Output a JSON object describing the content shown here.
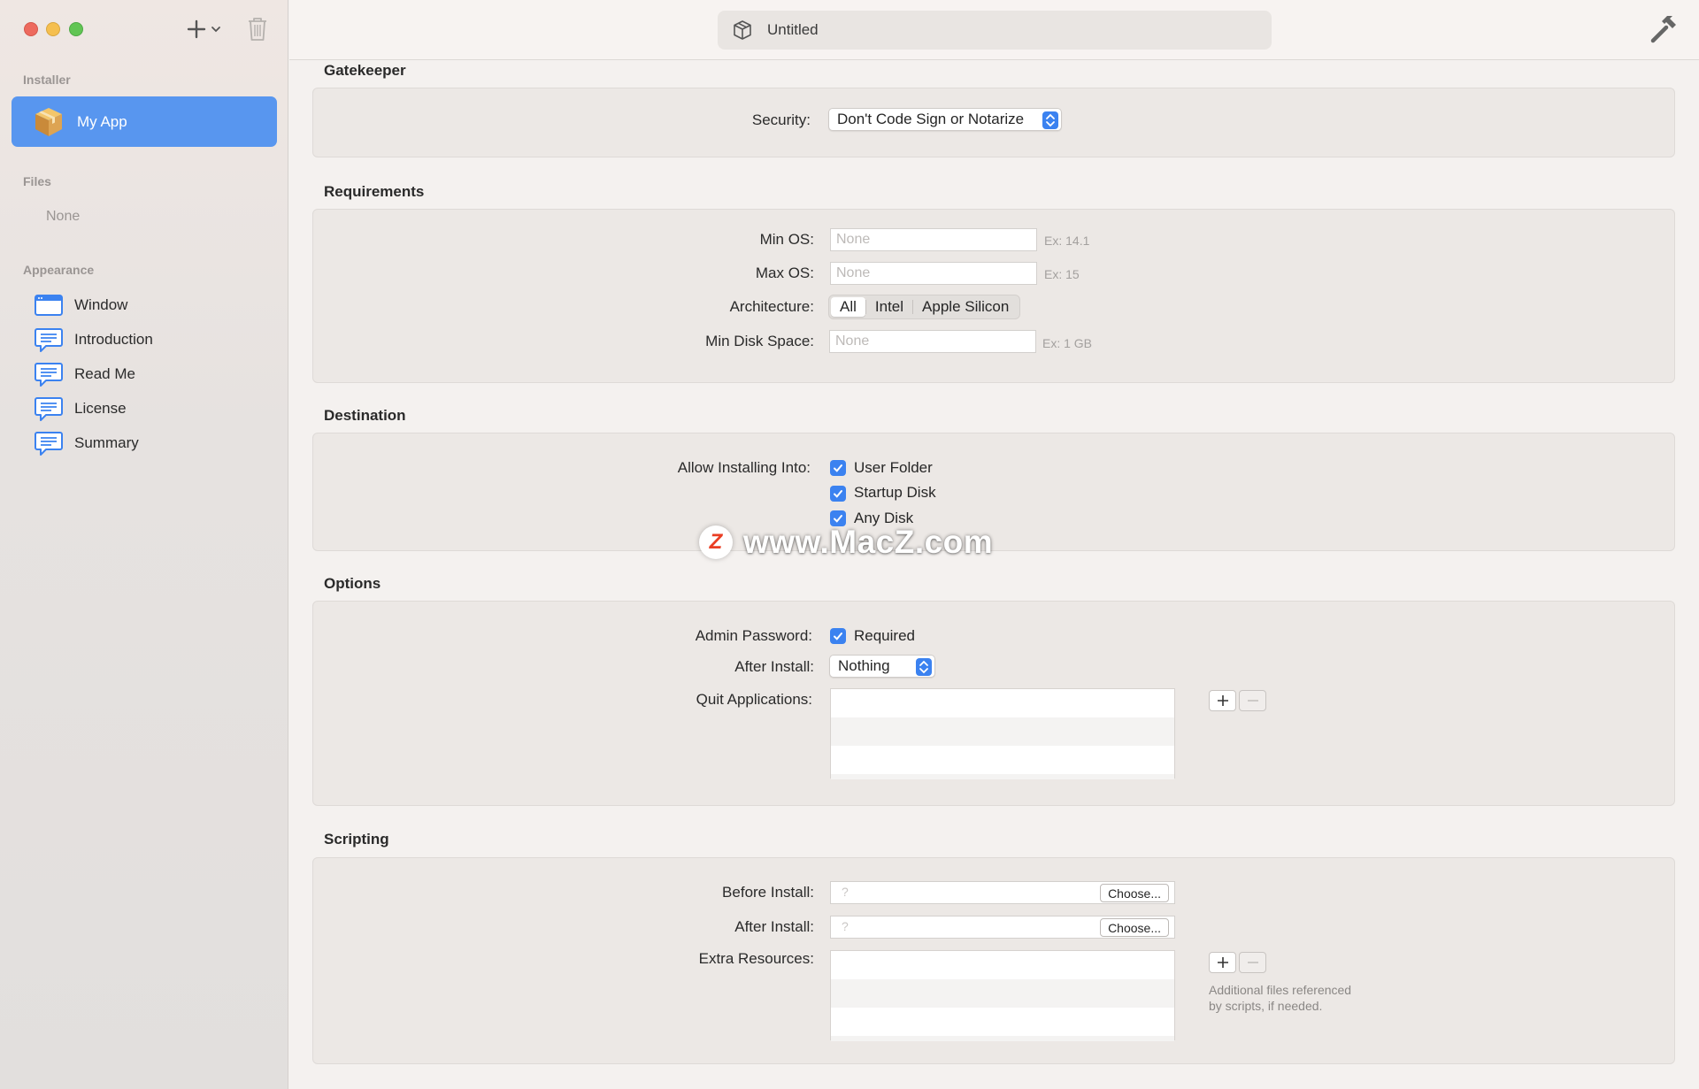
{
  "window": {
    "title": "Untitled"
  },
  "sidebar": {
    "sections": {
      "installer": "Installer",
      "files": "Files",
      "appearance": "Appearance"
    },
    "installer_item": "My App",
    "files_empty": "None",
    "appearance_items": [
      {
        "label": "Window",
        "icon": "window-icon"
      },
      {
        "label": "Introduction",
        "icon": "speech-bubble-icon"
      },
      {
        "label": "Read Me",
        "icon": "speech-bubble-icon"
      },
      {
        "label": "License",
        "icon": "speech-bubble-icon"
      },
      {
        "label": "Summary",
        "icon": "speech-bubble-icon"
      }
    ]
  },
  "gatekeeper": {
    "title": "Gatekeeper",
    "security_label": "Security:",
    "security_value": "Don't Code Sign or Notarize"
  },
  "requirements": {
    "title": "Requirements",
    "min_os_label": "Min OS:",
    "min_os_placeholder": "None",
    "min_os_hint": "Ex: 14.1",
    "max_os_label": "Max OS:",
    "max_os_placeholder": "None",
    "max_os_hint": "Ex: 15",
    "arch_label": "Architecture:",
    "arch_options": [
      "All",
      "Intel",
      "Apple Silicon"
    ],
    "arch_selected": "All",
    "disk_label": "Min Disk Space:",
    "disk_placeholder": "None",
    "disk_hint": "Ex: 1 GB"
  },
  "destination": {
    "title": "Destination",
    "allow_label": "Allow Installing Into:",
    "options": [
      {
        "label": "User Folder",
        "checked": true
      },
      {
        "label": "Startup Disk",
        "checked": true
      },
      {
        "label": "Any Disk",
        "checked": true
      }
    ]
  },
  "options": {
    "title": "Options",
    "admin_label": "Admin Password:",
    "admin_value": "Required",
    "admin_checked": true,
    "after_install_label": "After Install:",
    "after_install_value": "Nothing",
    "quit_label": "Quit Applications:"
  },
  "scripting": {
    "title": "Scripting",
    "before_label": "Before Install:",
    "after_label": "After Install:",
    "choose_label": "Choose...",
    "path_placeholder": "?",
    "extra_label": "Extra Resources:",
    "extra_note_line1": "Additional files referenced",
    "extra_note_line2": "by scripts, if needed."
  },
  "watermark": {
    "badge": "Z",
    "text": "www.MacZ.com"
  },
  "colors": {
    "accent": "#3b82f0",
    "selection": "#5896ef"
  }
}
